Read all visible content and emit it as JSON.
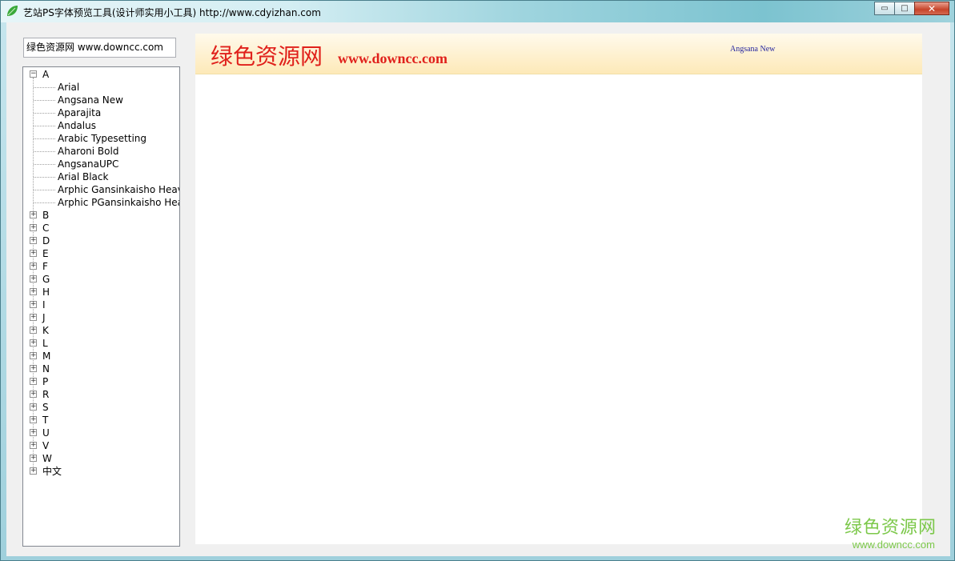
{
  "window": {
    "title": "艺站PS字体预览工具(设计师实用小工具) http://www.cdyizhan.com",
    "buttons": {
      "minimize": "▭",
      "maximize": "□",
      "close": "✕"
    }
  },
  "search": {
    "value": "绿色资源网 www.downcc.com"
  },
  "tree": {
    "expanded_group": {
      "label": "A",
      "items": [
        "Arial",
        "Angsana New",
        "Aparajita",
        "Andalus",
        "Arabic Typesetting",
        "Aharoni Bold",
        "AngsanaUPC",
        "Arial Black",
        "Arphic Gansinkaisho Heavy JIS",
        "Arphic PGansinkaisho Heavy JIS"
      ]
    },
    "collapsed_groups": [
      "B",
      "C",
      "D",
      "E",
      "F",
      "G",
      "H",
      "I",
      "J",
      "K",
      "L",
      "M",
      "N",
      "P",
      "R",
      "S",
      "T",
      "U",
      "V",
      "W",
      "中文"
    ]
  },
  "preview": {
    "banner_cn": "绿色资源网",
    "banner_url": "www.downcc.com",
    "font_name": "Angsana New"
  },
  "watermark": {
    "cn": "绿色资源网",
    "url": "www.downcc.com"
  }
}
